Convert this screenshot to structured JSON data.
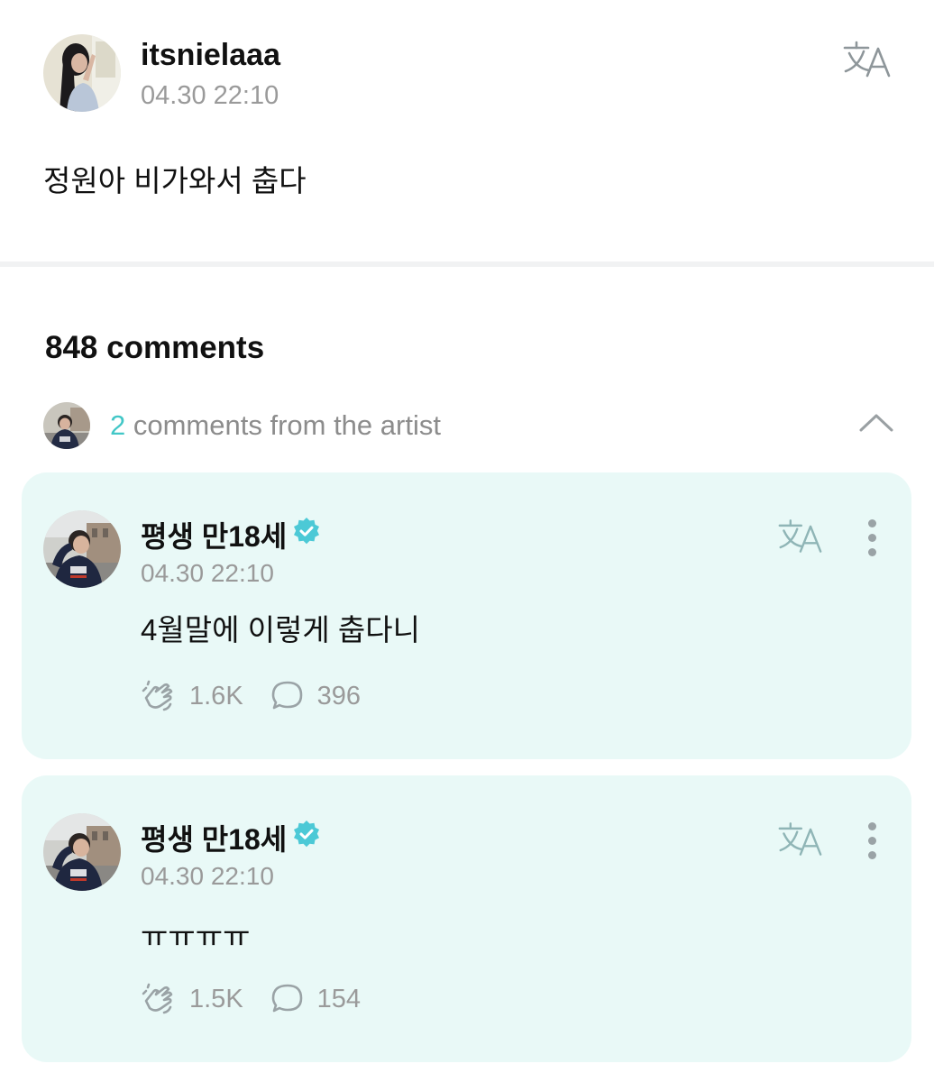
{
  "post": {
    "author": "itsnielaaa",
    "time": "04.30 22:10",
    "text": "정원아 비가와서 춥다"
  },
  "comments": {
    "count_label": "848 comments",
    "artist_count": "2",
    "artist_label": " comments from the artist"
  },
  "artist_comments": [
    {
      "name": "평생 만18세",
      "time": "04.30 22:10",
      "text": "4월말에 이렇게 춥다니",
      "likes": "1.6K",
      "replies": "396"
    },
    {
      "name": "평생 만18세",
      "time": "04.30 22:10",
      "text": "ㅠㅠㅠㅠ",
      "likes": "1.5K",
      "replies": "154"
    }
  ],
  "colors": {
    "accent": "#42c7c7",
    "card_bg": "#e9f9f7",
    "muted": "#9a9a9a"
  },
  "icons": {
    "translate": "translate-icon",
    "verified": "verified-badge-icon",
    "like": "cheer-hand-icon",
    "reply": "speech-bubble-icon",
    "more": "more-vertical-icon",
    "collapse": "chevron-up-icon"
  }
}
